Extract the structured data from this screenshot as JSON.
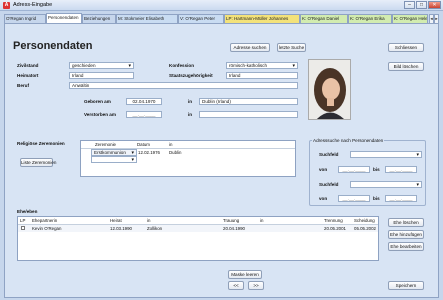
{
  "window": {
    "title": "Adress-Eingabe",
    "icon": "address-book-icon"
  },
  "window_controls": {
    "minimize": "–",
    "maximize": "□",
    "close": "✕"
  },
  "tabs": [
    {
      "label": "O'Regan Ingrid",
      "color": "#e8eef7"
    },
    {
      "label": "Personendaten",
      "color": "#ffffff"
    },
    {
      "label": "Beziehungen",
      "color": "#e8eef7"
    },
    {
      "label": "M: Stokmeier Elisabeth",
      "color": "#c9dcf2"
    },
    {
      "label": "V: O'Regan Peter",
      "color": "#c9dcf2"
    },
    {
      "label": "LP: Hartmann-Müller Johannes",
      "color": "#f3e27a"
    },
    {
      "label": "K: O'Regan Daniel",
      "color": "#d2ecb0"
    },
    {
      "label": "K: O'Regan Erika",
      "color": "#d2ecb0"
    },
    {
      "label": "K: O'Regan Hele",
      "color": "#d2ecb0"
    }
  ],
  "tab_scroll": {
    "left": "◂",
    "right": "▸"
  },
  "page_title": "Personendaten",
  "buttons": {
    "adresse_suchen": "Adresse suchen",
    "letzte_suche": "letzte Suche",
    "schliessen": "Schliessen",
    "bild_loeschen": "Bild löschen",
    "liste_zeremonien": "Liste Zeremonien",
    "ehe_loeschen": "Ehe löschen",
    "ehe_hinzufuegen": "Ehe hinzufügen",
    "ehe_bearbeiten": "Ehe bearbeiten",
    "maske_leeren": "Maske leeren",
    "prev": "<<",
    "next": ">>",
    "speichern": "Speichern"
  },
  "form": {
    "zivilstand": {
      "label": "Zivilstand",
      "value": "geschieden"
    },
    "konfession": {
      "label": "Konfession",
      "value": "römisch-katholisch"
    },
    "heimatort": {
      "label": "Heimatort",
      "value": "Irland"
    },
    "staatszugehoerigkeit": {
      "label": "Staatszugehörigkeit",
      "value": "Irland"
    },
    "beruf": {
      "label": "Beruf",
      "value": "Anwältin"
    },
    "geboren_am": {
      "label": "Geboren am",
      "value": "02.04.1970"
    },
    "geboren_in": {
      "label": "in",
      "value": "Dublin (Irland)"
    },
    "verstorben_am": {
      "label": "Verstorben am",
      "value": "__.__.____"
    },
    "verstorben_in": {
      "label": "in",
      "value": ""
    }
  },
  "zeremonien": {
    "title": "Religiöse Zeremonien",
    "columns": [
      "Zeremonie",
      "Datum",
      "in"
    ],
    "rows": [
      {
        "zeremonie": "Erstkommunion",
        "datum": "12.02.1976",
        "in": "Dublin"
      },
      {
        "zeremonie": "",
        "datum": "",
        "in": ""
      }
    ]
  },
  "adresssuche": {
    "title": "Adresssuche nach Personendaten",
    "suchfeld_label": "Suchfeld",
    "von_label": "von",
    "bis_label": "bis",
    "date_placeholder": "__.__.____",
    "suchfeld1": "",
    "suchfeld2": ""
  },
  "ehe": {
    "title": "Ehe/eben",
    "columns": [
      "LP",
      "Ehepartnerin",
      "Heirat",
      "in",
      "Trauung",
      "in",
      "Trennung",
      "Scheidung"
    ],
    "rows": [
      {
        "lp": "",
        "partner": "Kevin O'Regan",
        "heirat": "12.03.1990",
        "heirat_in": "Zollikon",
        "trauung": "20.04.1990",
        "trauung_in": "",
        "trennung": "20.05.2001",
        "scheidung": "05.05.2002"
      }
    ]
  },
  "photo": {
    "icon": "person-photo-icon"
  }
}
